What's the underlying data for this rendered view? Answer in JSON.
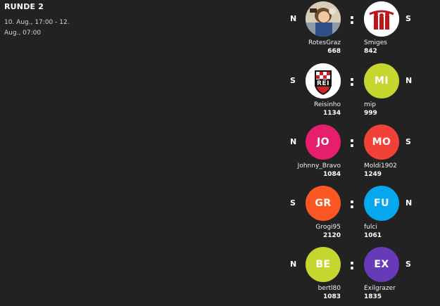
{
  "round": {
    "title": "RUNDE 2",
    "dates": "10. Aug., 17:00 - 12. Aug., 07:00"
  },
  "separator": ":",
  "matches": [
    {
      "home": {
        "tag": "N",
        "name": "RotesGraz",
        "score": "668",
        "avatar_icon": "cartoon-character-photo-icon"
      },
      "away": {
        "tag": "S",
        "name": "Smiges",
        "score": "842",
        "avatar_icon": "band-logo-icon"
      }
    },
    {
      "home": {
        "tag": "S",
        "name": "Reisinho",
        "score": "1134",
        "avatar_icon": "shield-crest-icon",
        "crest_text": "REI"
      },
      "away": {
        "tag": "N",
        "name": "mip",
        "score": "999",
        "initials": "MI",
        "color": "#c5d62f"
      }
    },
    {
      "home": {
        "tag": "N",
        "name": "Johnny_Bravo",
        "score": "1084",
        "initials": "JO",
        "color": "#e51f6b"
      },
      "away": {
        "tag": "S",
        "name": "Moldi1902",
        "score": "1249",
        "initials": "MO",
        "color": "#f24137"
      }
    },
    {
      "home": {
        "tag": "S",
        "name": "Grogi95",
        "score": "2120",
        "initials": "GR",
        "color": "#fb5722"
      },
      "away": {
        "tag": "N",
        "name": "fulci",
        "score": "1061",
        "initials": "FU",
        "color": "#05a7ee"
      }
    },
    {
      "home": {
        "tag": "N",
        "name": "bertl80",
        "score": "1083",
        "initials": "BE",
        "color": "#c5d62f"
      },
      "away": {
        "tag": "S",
        "name": "Exilgrazer",
        "score": "1835",
        "initials": "EX",
        "color": "#673ab7"
      }
    }
  ]
}
